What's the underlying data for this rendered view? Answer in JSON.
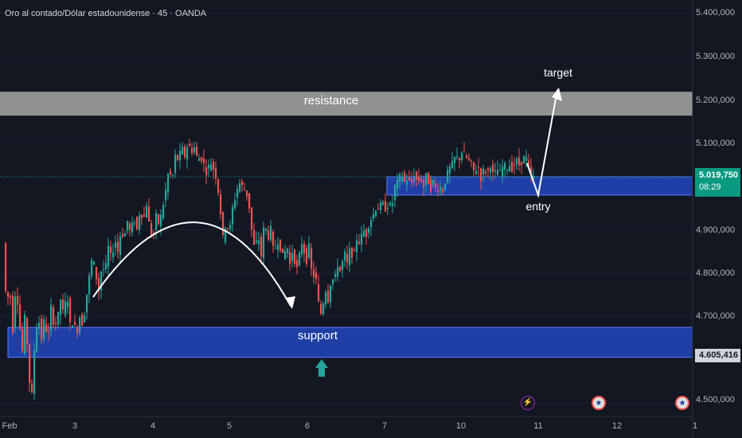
{
  "header": {
    "title": "Oro al contado/Dólar estadounidense · 45 · OANDA"
  },
  "price_axis": {
    "labels": [
      "5.400,000",
      "5.300,000",
      "5.200,000",
      "5.100,000",
      "4.900,000",
      "4.800,000",
      "4.700,000",
      "4.500,000"
    ],
    "last_price": "5.019,750",
    "countdown": "08:29",
    "support_price": "4.605,416"
  },
  "date_axis": {
    "labels": [
      "Feb",
      "3",
      "4",
      "5",
      "6",
      "7",
      "10",
      "11",
      "12",
      "1"
    ]
  },
  "annotations": {
    "resistance": "resistance",
    "support": "support",
    "entry": "entry",
    "target": "target"
  },
  "icons": {
    "lightning": "lightning-icon",
    "us_flag": "us-flag-icon"
  },
  "colors": {
    "background": "#131722",
    "up": "#26a69a",
    "down": "#ef5350",
    "zone_blue": "#1f3fa6",
    "resistance_gray": "#9e9e9e",
    "last_price_green": "#089981"
  },
  "chart_data": {
    "type": "candlestick",
    "title": "Oro al contado/Dólar estadounidense · 45 · OANDA",
    "ylim": [
      4450,
      5450
    ],
    "y_ticks": [
      4500,
      4700,
      4800,
      4900,
      5100,
      5200,
      5300,
      5400
    ],
    "x_ticks": [
      "Feb",
      "3",
      "4",
      "5",
      "6",
      "7",
      "10",
      "11",
      "12",
      "1"
    ],
    "last_price": 5019.75,
    "zones": [
      {
        "name": "resistance",
        "from": 5163,
        "to": 5218
      },
      {
        "name": "support",
        "from": 4606,
        "to": 4675
      },
      {
        "name": "entry",
        "from": 4980,
        "to": 5022
      }
    ],
    "path": [
      [
        0,
        4870
      ],
      [
        4,
        4720
      ],
      [
        8,
        4770
      ],
      [
        12,
        4670
      ],
      [
        16,
        4780
      ],
      [
        20,
        4690
      ],
      [
        24,
        4620
      ],
      [
        28,
        4720
      ],
      [
        32,
        4560
      ],
      [
        36,
        4520
      ],
      [
        40,
        4660
      ],
      [
        44,
        4700
      ],
      [
        48,
        4650
      ],
      [
        52,
        4700
      ],
      [
        56,
        4640
      ],
      [
        60,
        4720
      ],
      [
        64,
        4680
      ],
      [
        68,
        4690
      ],
      [
        72,
        4740
      ],
      [
        76,
        4700
      ],
      [
        80,
        4760
      ],
      [
        84,
        4680
      ],
      [
        88,
        4690
      ],
      [
        92,
        4660
      ],
      [
        96,
        4700
      ],
      [
        100,
        4680
      ],
      [
        104,
        4740
      ],
      [
        108,
        4790
      ],
      [
        112,
        4840
      ],
      [
        116,
        4800
      ],
      [
        120,
        4760
      ],
      [
        124,
        4820
      ],
      [
        128,
        4800
      ],
      [
        132,
        4860
      ],
      [
        136,
        4830
      ],
      [
        140,
        4880
      ],
      [
        144,
        4850
      ],
      [
        148,
        4900
      ],
      [
        152,
        4880
      ],
      [
        156,
        4920
      ],
      [
        160,
        4890
      ],
      [
        164,
        4930
      ],
      [
        168,
        4900
      ],
      [
        172,
        4950
      ],
      [
        176,
        4920
      ],
      [
        180,
        4960
      ],
      [
        184,
        4900
      ],
      [
        188,
        4880
      ],
      [
        192,
        4930
      ],
      [
        196,
        4910
      ],
      [
        200,
        4950
      ],
      [
        204,
        4990
      ],
      [
        208,
        5040
      ],
      [
        212,
        5010
      ],
      [
        216,
        5070
      ],
      [
        220,
        5060
      ],
      [
        224,
        5090
      ],
      [
        228,
        5070
      ],
      [
        232,
        5100
      ],
      [
        236,
        5080
      ],
      [
        240,
        5090
      ],
      [
        244,
        5060
      ],
      [
        248,
        5070
      ],
      [
        252,
        5050
      ],
      [
        256,
        5030
      ],
      [
        260,
        5060
      ],
      [
        264,
        5040
      ],
      [
        268,
        5020
      ],
      [
        272,
        4960
      ],
      [
        276,
        4880
      ],
      [
        280,
        4920
      ],
      [
        284,
        4890
      ],
      [
        288,
        4950
      ],
      [
        292,
        4980
      ],
      [
        296,
        5010
      ],
      [
        300,
        5000
      ],
      [
        304,
        4990
      ],
      [
        308,
        4970
      ],
      [
        312,
        4900
      ],
      [
        316,
        4850
      ],
      [
        320,
        4890
      ],
      [
        324,
        4840
      ],
      [
        328,
        4920
      ],
      [
        332,
        4880
      ],
      [
        336,
        4900
      ],
      [
        340,
        4840
      ],
      [
        344,
        4880
      ],
      [
        348,
        4860
      ],
      [
        352,
        4830
      ],
      [
        356,
        4870
      ],
      [
        360,
        4820
      ],
      [
        364,
        4860
      ],
      [
        368,
        4800
      ],
      [
        372,
        4840
      ],
      [
        376,
        4880
      ],
      [
        380,
        4820
      ],
      [
        384,
        4860
      ],
      [
        388,
        4790
      ],
      [
        392,
        4800
      ],
      [
        396,
        4730
      ],
      [
        400,
        4700
      ],
      [
        404,
        4770
      ],
      [
        408,
        4740
      ],
      [
        412,
        4790
      ],
      [
        416,
        4780
      ],
      [
        420,
        4820
      ],
      [
        424,
        4800
      ],
      [
        428,
        4850
      ],
      [
        432,
        4820
      ],
      [
        436,
        4860
      ],
      [
        440,
        4830
      ],
      [
        444,
        4880
      ],
      [
        448,
        4870
      ],
      [
        452,
        4900
      ],
      [
        456,
        4890
      ],
      [
        460,
        4920
      ],
      [
        464,
        4930
      ],
      [
        468,
        4950
      ],
      [
        472,
        4950
      ],
      [
        476,
        4960
      ],
      [
        480,
        4950
      ],
      [
        484,
        4960
      ],
      [
        488,
        4950
      ],
      [
        492,
        5000
      ],
      [
        496,
        5010
      ],
      [
        500,
        5030
      ],
      [
        504,
        5010
      ],
      [
        508,
        5020
      ],
      [
        512,
        5000
      ],
      [
        516,
        5030
      ],
      [
        520,
        5010
      ],
      [
        524,
        5020
      ],
      [
        528,
        5000
      ],
      [
        532,
        5030
      ],
      [
        536,
        4990
      ],
      [
        540,
        5010
      ],
      [
        544,
        4990
      ],
      [
        548,
        5000
      ],
      [
        552,
        4990
      ],
      [
        556,
        5020
      ],
      [
        560,
        5040
      ],
      [
        564,
        5050
      ],
      [
        568,
        5070
      ],
      [
        572,
        5060
      ],
      [
        576,
        5080
      ],
      [
        580,
        5070
      ],
      [
        584,
        5060
      ],
      [
        588,
        5050
      ],
      [
        592,
        5030
      ],
      [
        596,
        5050
      ],
      [
        600,
        5020
      ],
      [
        604,
        5040
      ],
      [
        608,
        5030
      ],
      [
        612,
        5050
      ],
      [
        616,
        5020
      ],
      [
        620,
        5040
      ],
      [
        624,
        5030
      ],
      [
        628,
        5050
      ],
      [
        632,
        5040
      ],
      [
        636,
        5050
      ],
      [
        640,
        5040
      ],
      [
        644,
        5060
      ],
      [
        648,
        5050
      ],
      [
        652,
        5060
      ],
      [
        656,
        5070
      ],
      [
        660,
        5040
      ],
      [
        664,
        5020
      ]
    ]
  }
}
